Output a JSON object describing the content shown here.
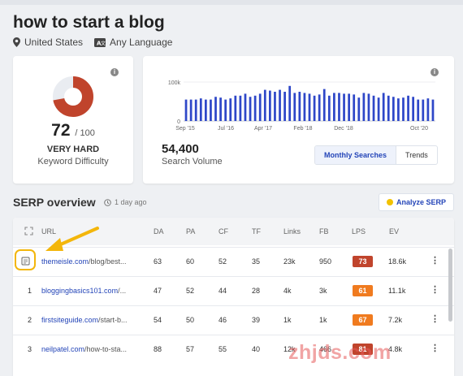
{
  "page_title": "how to start a blog",
  "meta": {
    "location": "United States",
    "language": "Any Language",
    "location_icon": "location-pin-icon",
    "language_icon": "translate-icon"
  },
  "keyword_difficulty": {
    "value": "72",
    "max": "/ 100",
    "level": "VERY HARD",
    "label": "Keyword Difficulty",
    "fraction": 0.72,
    "color": "#c0442c"
  },
  "search_volume": {
    "value": "54,400",
    "label": "Search Volume",
    "tabs": [
      "Monthly Searches",
      "Trends"
    ],
    "active_tab": "Monthly Searches"
  },
  "chart_data": {
    "type": "bar",
    "y_ticks": [
      "100k",
      "0"
    ],
    "x_ticks": [
      "Sep '15",
      "Jul '16",
      "Apr '17",
      "Feb '18",
      "Dec '18",
      "Oct '20"
    ],
    "values": [
      55,
      55,
      55,
      58,
      55,
      55,
      62,
      60,
      55,
      58,
      65,
      65,
      70,
      62,
      65,
      70,
      80,
      78,
      75,
      80,
      75,
      90,
      72,
      75,
      72,
      70,
      65,
      68,
      82,
      65,
      72,
      72,
      70,
      70,
      68,
      60,
      72,
      70,
      65,
      60,
      72,
      65,
      62,
      58,
      60,
      65,
      62,
      55,
      55,
      58,
      55
    ],
    "bar_color": "#2e47c8",
    "ylim": [
      0,
      100
    ]
  },
  "serp": {
    "title": "SERP overview",
    "time": "1 day ago",
    "analyze_label": "Analyze SERP",
    "columns": [
      "URL",
      "DA",
      "PA",
      "CF",
      "TF",
      "Links",
      "FB",
      "LPS",
      "EV"
    ],
    "rows": [
      {
        "rank": "",
        "domain": "themeisle.com",
        "path": "/blog/best...",
        "da": "63",
        "pa": "60",
        "cf": "52",
        "tf": "35",
        "links": "23k",
        "fb": "950",
        "lps": "73",
        "lps_color": "#c0442c",
        "ev": "18.6k"
      },
      {
        "rank": "1",
        "domain": "bloggingbasics101.com",
        "path": "/...",
        "da": "47",
        "pa": "52",
        "cf": "44",
        "tf": "28",
        "links": "4k",
        "fb": "3k",
        "lps": "61",
        "lps_color": "#f07b1f",
        "ev": "11.1k"
      },
      {
        "rank": "2",
        "domain": "firstsiteguide.com",
        "path": "/start-b...",
        "da": "54",
        "pa": "50",
        "cf": "46",
        "tf": "39",
        "links": "1k",
        "fb": "1k",
        "lps": "67",
        "lps_color": "#f07b1f",
        "ev": "7.2k"
      },
      {
        "rank": "3",
        "domain": "neilpatel.com",
        "path": "/how-to-sta...",
        "da": "88",
        "pa": "57",
        "cf": "55",
        "tf": "40",
        "links": "12k",
        "fb": "466",
        "lps": "81",
        "lps_color": "#c0442c",
        "ev": "4.8k"
      }
    ]
  },
  "watermark": "zhjds.com"
}
